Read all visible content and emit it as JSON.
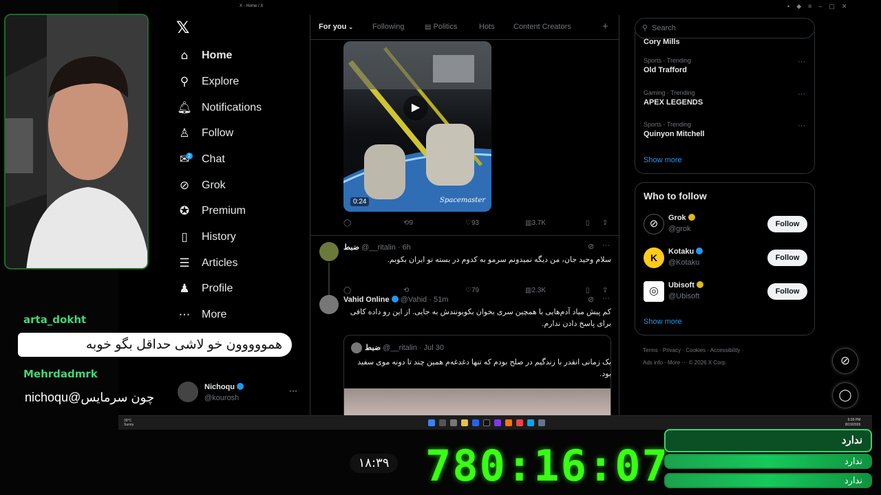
{
  "window": {
    "title": "X - Home / X"
  },
  "nav": {
    "items": [
      {
        "label": "Home",
        "icon": "home-icon"
      },
      {
        "label": "Explore",
        "icon": "search-icon"
      },
      {
        "label": "Notifications",
        "icon": "bell-icon"
      },
      {
        "label": "Follow",
        "icon": "person-plus-icon"
      },
      {
        "label": "Chat",
        "icon": "chat-icon",
        "badge": "2"
      },
      {
        "label": "Grok",
        "icon": "grok-icon"
      },
      {
        "label": "Premium",
        "icon": "premium-icon"
      },
      {
        "label": "History",
        "icon": "bookmark-icon"
      },
      {
        "label": "Articles",
        "icon": "articles-icon"
      },
      {
        "label": "Profile",
        "icon": "person-icon"
      },
      {
        "label": "More",
        "icon": "more-circle-icon"
      }
    ],
    "account": {
      "name": "Nichoqu",
      "handle": "@kourosh"
    }
  },
  "tabs": [
    "For you",
    "Following",
    "Politics",
    "Hots",
    "Content Creators"
  ],
  "video": {
    "duration": "0:24",
    "watermark": "Spacemaster"
  },
  "post1_actions": {
    "replies": "",
    "reposts": "9",
    "likes": "93",
    "views": "3.7K"
  },
  "post2": {
    "name": "ضبط",
    "handle": "@__ritalin",
    "time": "6h",
    "text": "سلام وحید جان، من دیگه نمیدونم سرمو به کدوم در بسته تو ایران بکوبم.",
    "likes": "79",
    "views": "2.3K"
  },
  "post3": {
    "name": "Vahid Online",
    "handle": "@Vahid",
    "time": "51m",
    "text": "کم پیش میاد آدم‌هایی با همچین سری بخوان بکوبونندش به جایی. از این رو داده کافی برای پاسخ دادن ندارم."
  },
  "quote": {
    "name": "ضبط",
    "handle": "@__ritalin",
    "time": "Jul 30",
    "text": "یک زمانی انقدر با زندگیم در صلح بودم که تنها دغدغه‌م همین چند تا دونه موی سفید بود."
  },
  "search": {
    "placeholder": "Search"
  },
  "trends": [
    {
      "category": "",
      "name": "Cory Mills"
    },
    {
      "category": "Sports · Trending",
      "name": "Old Trafford"
    },
    {
      "category": "Gaming · Trending",
      "name": "APEX LEGENDS"
    },
    {
      "category": "Sports · Trending",
      "name": "Quinyon Mitchell"
    }
  ],
  "show_more": "Show more",
  "who_to_follow": {
    "title": "Who to follow",
    "accounts": [
      {
        "name": "Grok",
        "handle": "@grok",
        "button": "Follow"
      },
      {
        "name": "Kotaku",
        "handle": "@Kotaku",
        "button": "Follow"
      },
      {
        "name": "Ubisoft",
        "handle": "@Ubisoft",
        "button": "Follow"
      }
    ],
    "show_more": "Show more"
  },
  "footer": {
    "line1": "Terms ·  Privacy ·  Cookies ·  Accessibility ·",
    "line2": "Ads info ·  More ···  © 2026 X Corp."
  },
  "taskbar": {
    "weather_temp": "39°C",
    "weather_desc": "Sunny",
    "time": "6:39 PM",
    "date": "8/19/2026"
  },
  "overlay": {
    "chat": [
      {
        "user": "arta_dokht",
        "message": "همووووون خو لاشی حداقل بگو خوبه"
      },
      {
        "user": "Mehrdadmrk",
        "message": "چون سرمایس@nichoqu"
      }
    ],
    "clock": "۱۸:۳۹",
    "timer": "780:16:07",
    "goal_title": "ندارد",
    "goal_row1": "ندارد",
    "goal_row2": "ندارد"
  },
  "colors": {
    "accent": "#1d9bf0",
    "overlay_green": "#39ff14",
    "background": "#000000"
  }
}
